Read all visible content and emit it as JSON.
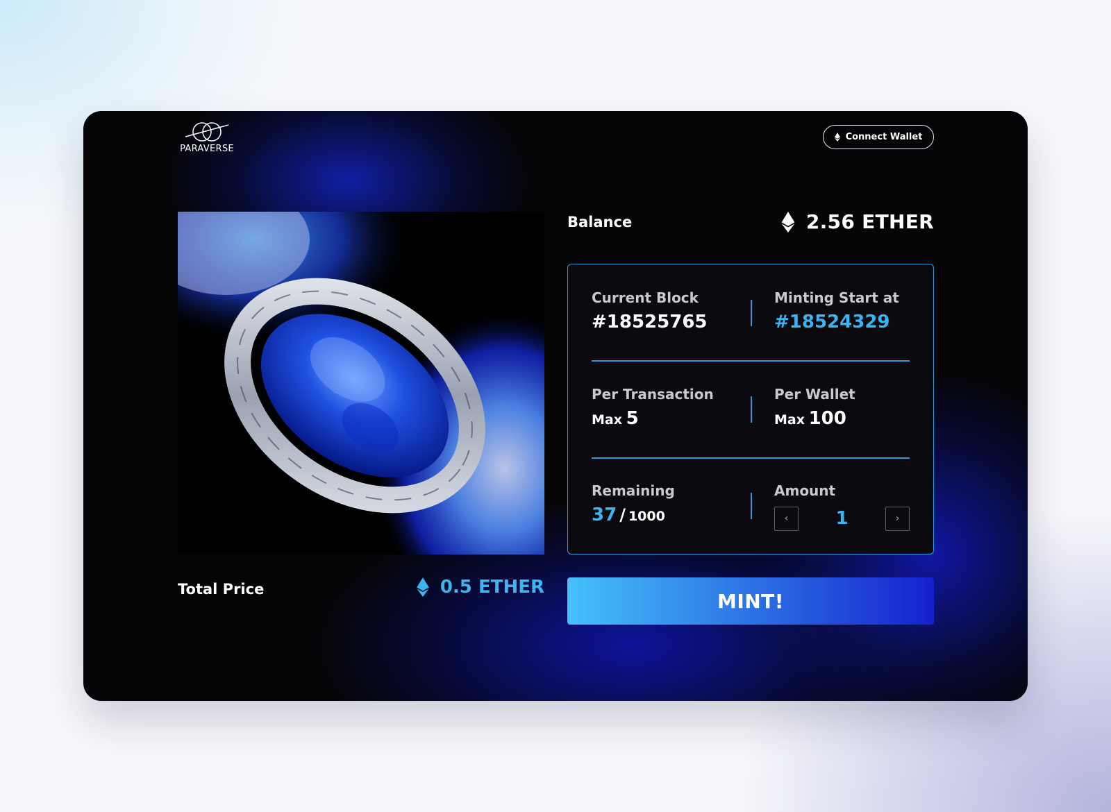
{
  "brand": {
    "name": "PARAVERSE"
  },
  "header": {
    "connect_wallet_label": "Connect Wallet"
  },
  "balance": {
    "label": "Balance",
    "value": "2.56 ETHER"
  },
  "info": {
    "current_block": {
      "label": "Current Block",
      "value": "#18525765"
    },
    "minting_start": {
      "label": "Minting Start at",
      "value": "#18524329"
    },
    "per_transaction": {
      "label": "Per Transaction",
      "max_prefix": "Max",
      "max_value": "5"
    },
    "per_wallet": {
      "label": "Per Wallet",
      "max_prefix": "Max",
      "max_value": "100"
    },
    "remaining": {
      "label": "Remaining",
      "value": "37",
      "separator": "/",
      "total": "1000"
    },
    "amount": {
      "label": "Amount",
      "value": "1",
      "decrement_glyph": "‹",
      "increment_glyph": "›"
    }
  },
  "total": {
    "label": "Total Price",
    "value": "0.5 ETHER"
  },
  "mint_button": {
    "label": "MINT!"
  },
  "colors": {
    "accent": "#3fb2f0",
    "border": "#2f9ad9",
    "card_bg": "#050507",
    "mint_gradient_start": "#46c1fb",
    "mint_gradient_end": "#1521cf"
  },
  "icons": {
    "logo": "interlocked-rings-logo",
    "ether": "ethereum-icon"
  }
}
